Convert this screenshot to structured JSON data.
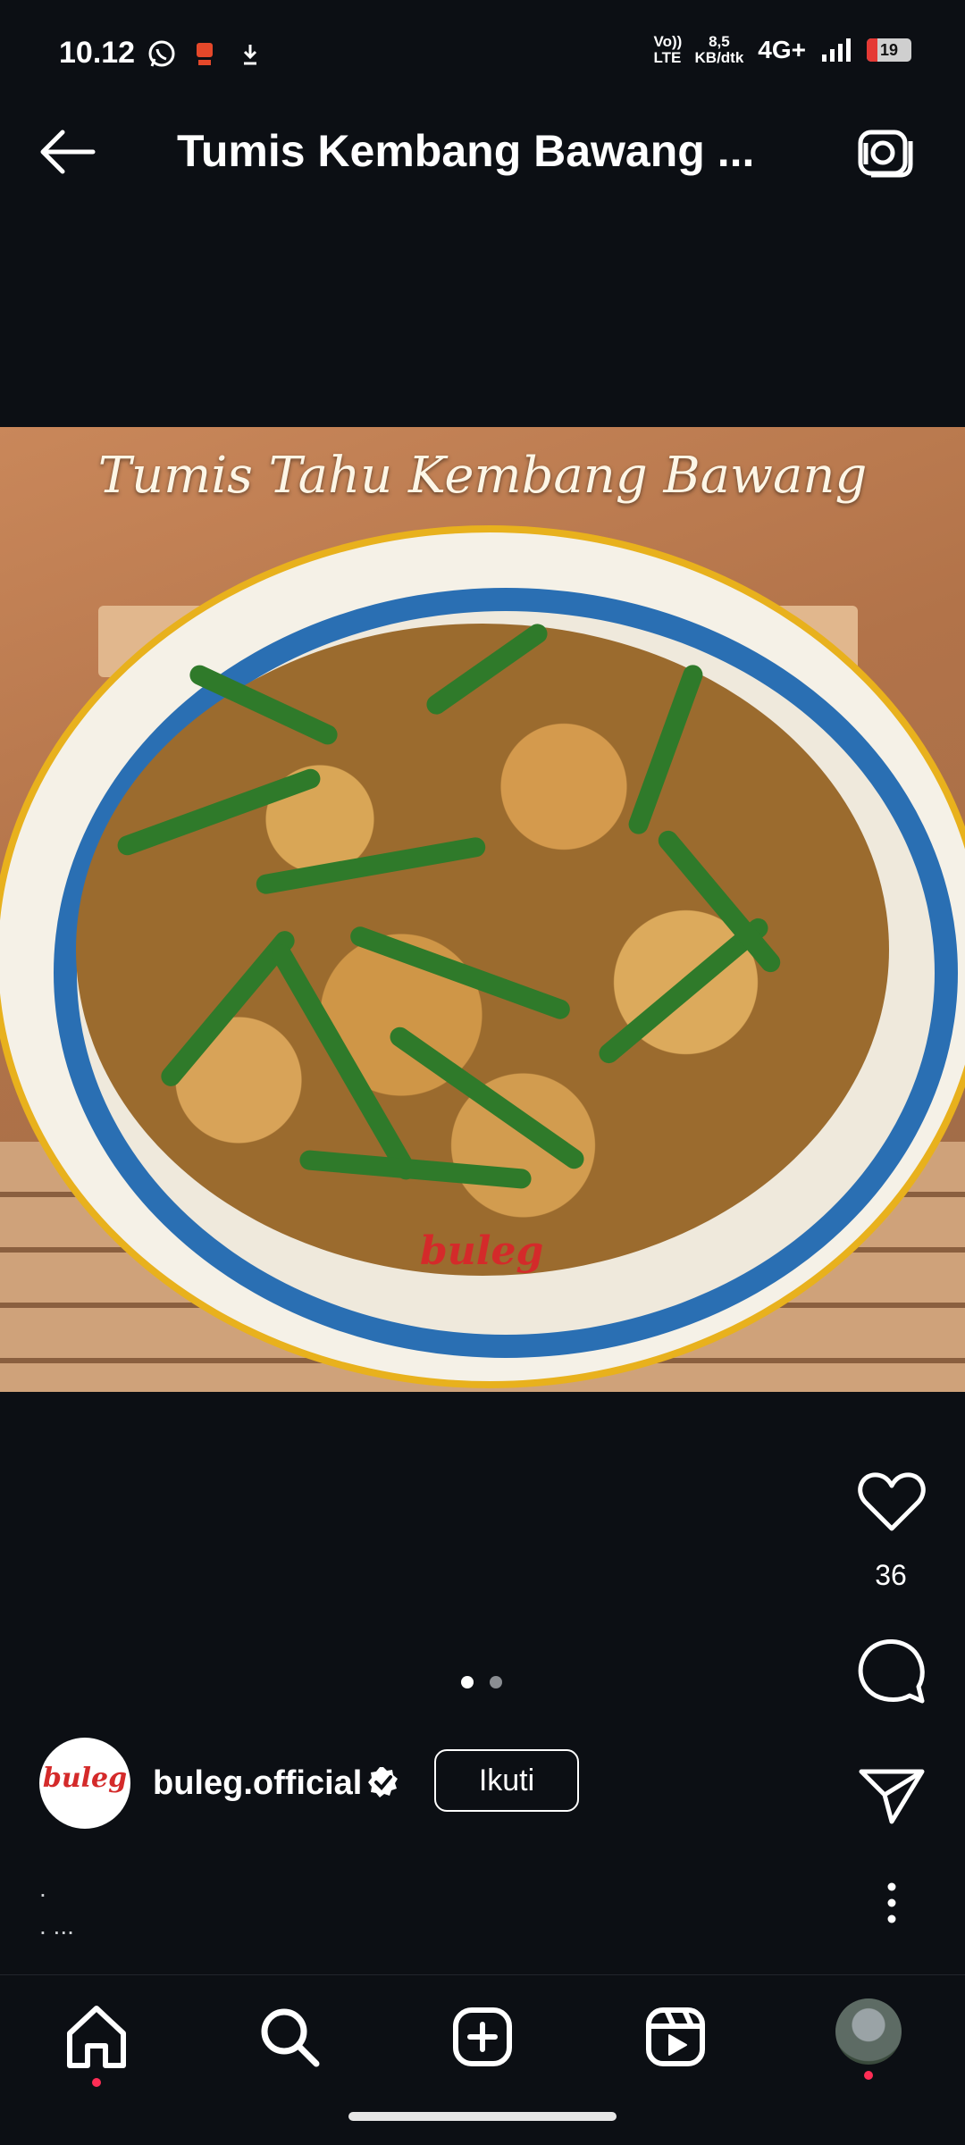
{
  "status_bar": {
    "time": "10.12",
    "volte": "Vo)) LTE",
    "speed_value": "8,5",
    "speed_unit": "KB/dtk",
    "network": "4G+",
    "battery": "19"
  },
  "header": {
    "title": "Tumis Kembang Bawang ...",
    "back_icon": "arrow-left-icon",
    "camera_icon": "camera-icon"
  },
  "post": {
    "image_overlay_title": "Tumis Tahu Kembang Bawang",
    "image_watermark": "buleg",
    "carousel": {
      "total": 2,
      "active_index": 0
    },
    "likes": "36",
    "author": {
      "username": "buleg.official",
      "avatar_logo": "buleg",
      "verified": true
    },
    "follow_label": "Ikuti",
    "caption_line1": ".",
    "caption_line2": ". ..."
  },
  "bottom_nav": [
    {
      "name": "home",
      "icon": "home-icon",
      "notification": true
    },
    {
      "name": "search",
      "icon": "search-icon",
      "notification": false
    },
    {
      "name": "create",
      "icon": "plus-square-icon",
      "notification": false
    },
    {
      "name": "reels",
      "icon": "reels-icon",
      "notification": false
    },
    {
      "name": "profile",
      "icon": "profile-avatar",
      "notification": true
    }
  ],
  "colors": {
    "background": "#0c0f14",
    "notification": "#ff2d55",
    "plate_rim": "#e8b11d",
    "plate_blue": "#2a6fb3"
  }
}
